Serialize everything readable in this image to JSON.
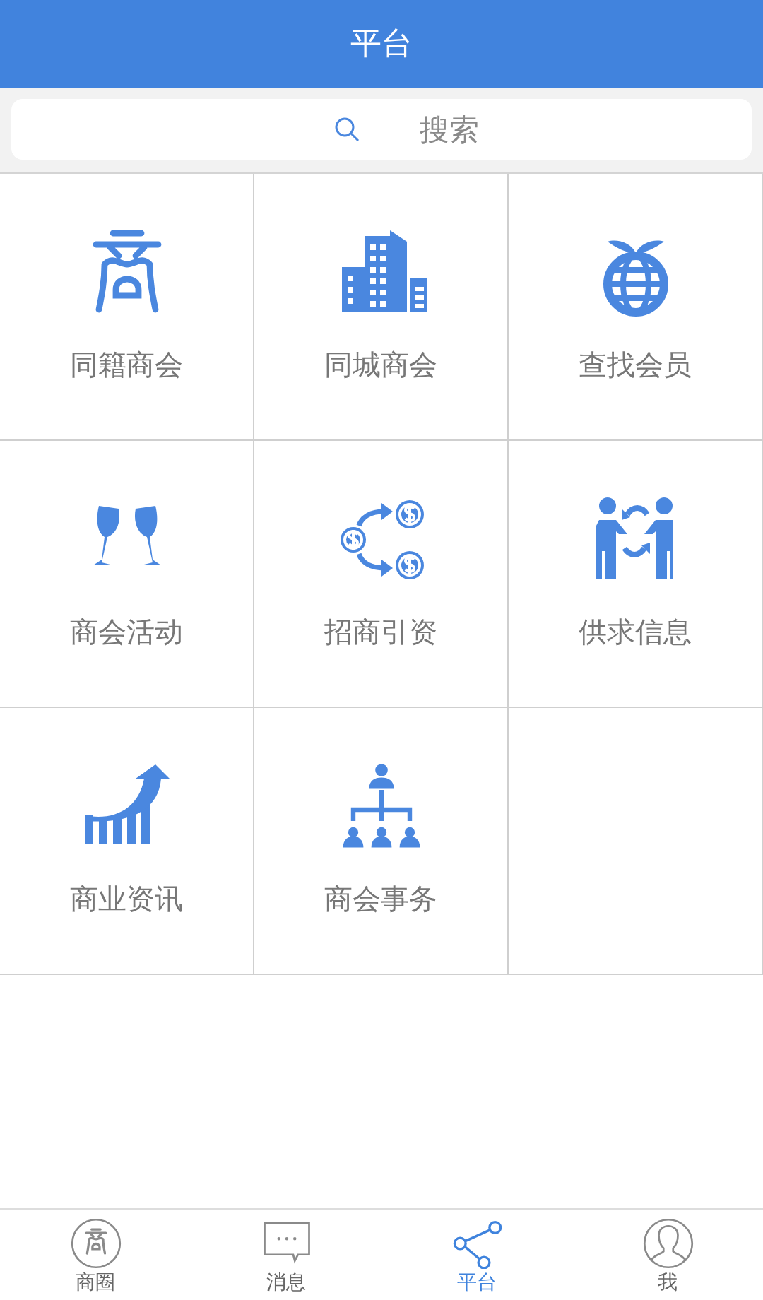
{
  "header": {
    "title": "平台"
  },
  "search": {
    "placeholder": "搜索"
  },
  "grid": [
    {
      "kind": "emblem",
      "label": "同籍商会"
    },
    {
      "kind": "buildings",
      "label": "同城商会"
    },
    {
      "kind": "globe",
      "label": "查找会员"
    },
    {
      "kind": "glasses",
      "label": "商会活动"
    },
    {
      "kind": "money",
      "label": "招商引资"
    },
    {
      "kind": "exchange",
      "label": "供求信息"
    },
    {
      "kind": "growth",
      "label": "商业资讯"
    },
    {
      "kind": "org",
      "label": "商会事务"
    }
  ],
  "tab_bar": [
    {
      "kind": "emblem",
      "label": "商圈",
      "selected": false
    },
    {
      "kind": "message",
      "label": "消息",
      "selected": false
    },
    {
      "kind": "share",
      "label": "平台",
      "selected": true
    },
    {
      "kind": "person",
      "label": "我",
      "selected": false
    }
  ]
}
